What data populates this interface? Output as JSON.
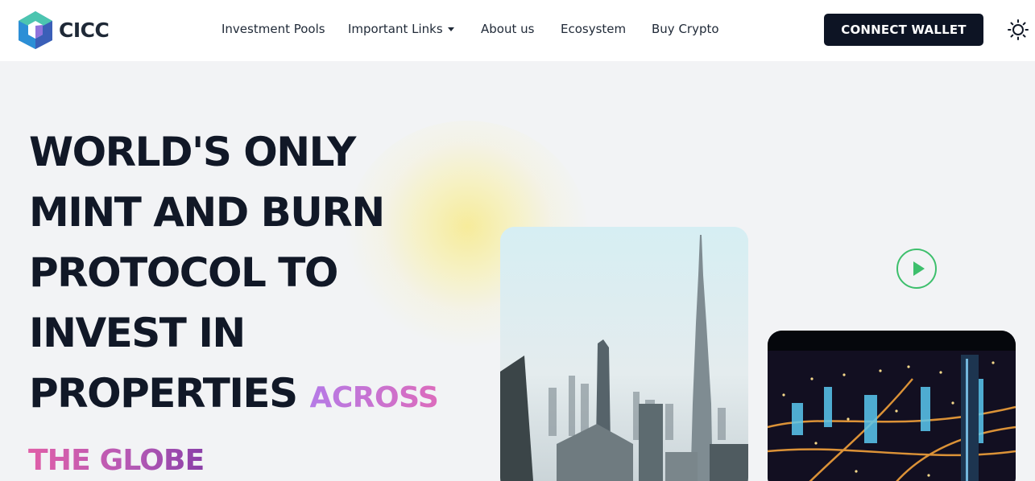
{
  "brand": {
    "name": "CICC",
    "logo_icon": "hexagon-cube-logo"
  },
  "nav": {
    "items": [
      {
        "label": "Investment Pools"
      },
      {
        "label": "Important Links",
        "icon": "caret-down-icon"
      },
      {
        "label": "About us"
      },
      {
        "label": "Ecosystem"
      },
      {
        "label": "Buy Crypto"
      }
    ]
  },
  "header": {
    "connect_label": "CONNECT WALLET",
    "theme_icon": "sun-icon"
  },
  "hero": {
    "title_lines": [
      "WORLD'S ONLY",
      "MINT AND BURN",
      "PROTOCOL TO",
      "INVEST IN",
      "PROPERTIES"
    ],
    "accent_1": "ACROSS",
    "accent_2": "THE GLOBE",
    "play_icon": "play-icon",
    "images": [
      "city-skyline-day-photo",
      "city-night-aerial-photo"
    ]
  },
  "colors": {
    "background": "#f2f3f5",
    "header": "#ffffff",
    "button": "#0d1424",
    "title": "#111827",
    "accent_gradient": [
      "#b57ae6",
      "#dc6bbc"
    ],
    "play": "#3dbf6c"
  }
}
